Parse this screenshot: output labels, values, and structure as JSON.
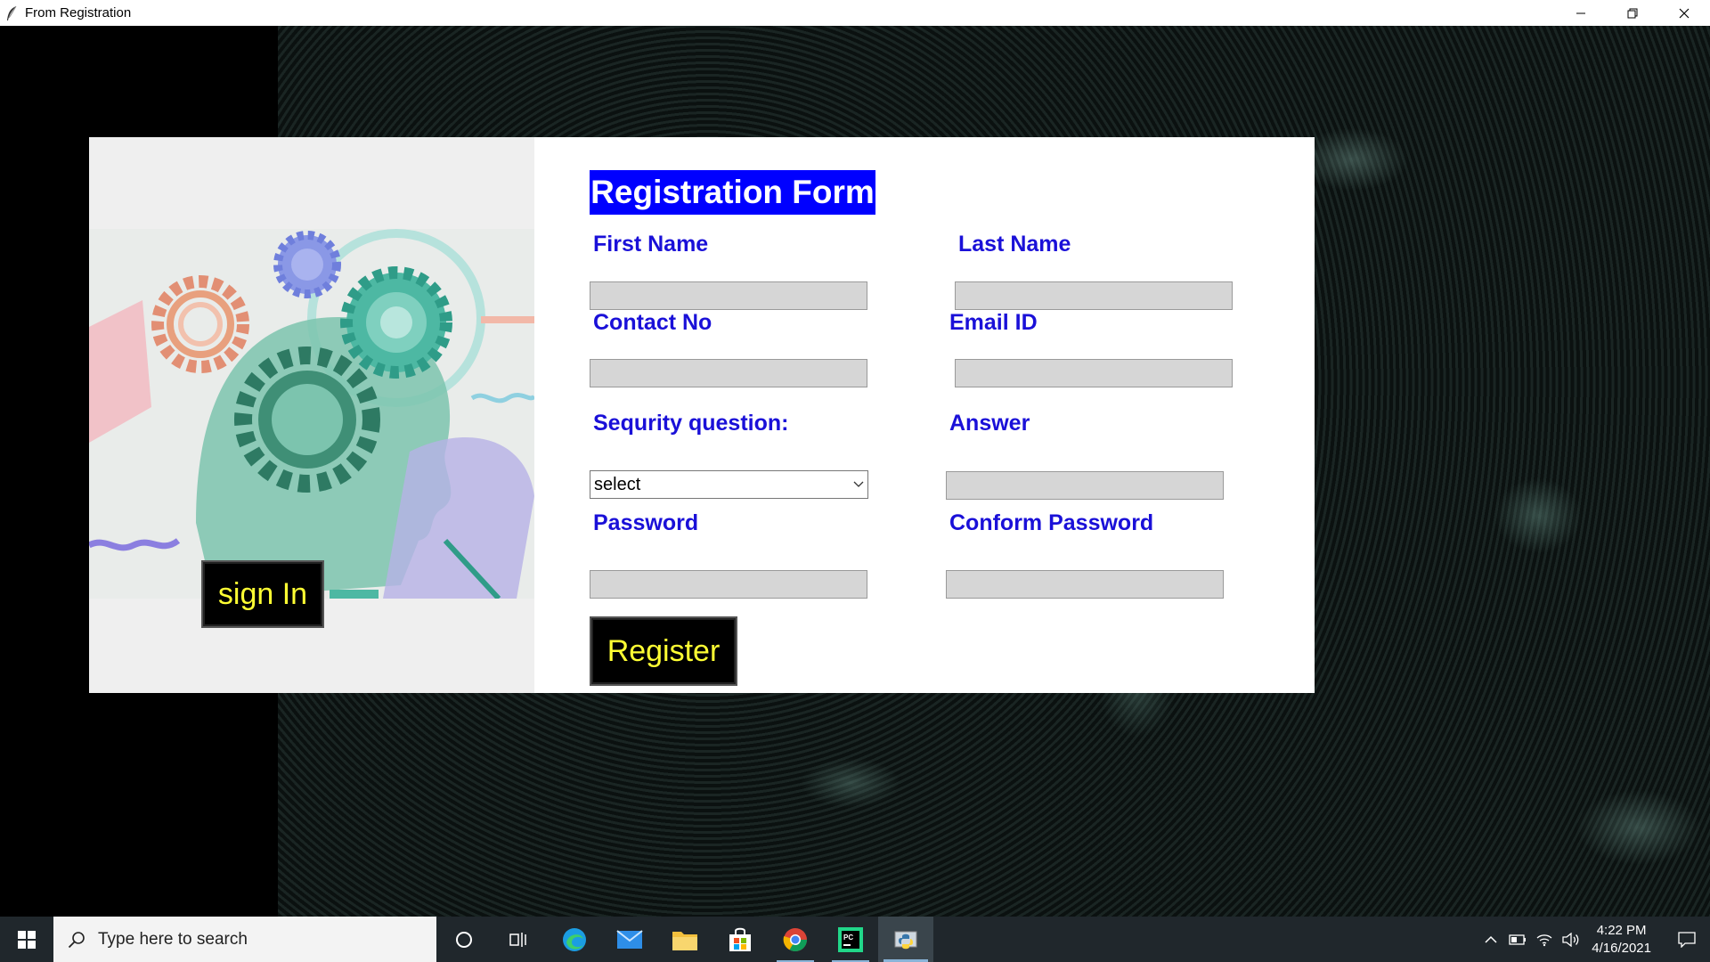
{
  "window": {
    "title": "From Registration",
    "controls": [
      "minimize",
      "restore",
      "close"
    ]
  },
  "left_panel": {
    "illustration": "head-with-gears-illustration",
    "signin_label": "sign In"
  },
  "form": {
    "title": "Registration Form",
    "first_name_label": "First Name",
    "first_name_value": "",
    "last_name_label": "Last Name",
    "last_name_value": "",
    "contact_label": "Contact No",
    "contact_value": "",
    "email_label": "Email ID",
    "email_value": "",
    "security_label": "Sequrity question:",
    "security_selected": "select",
    "answer_label": "Answer",
    "answer_value": "",
    "password_label": "Password",
    "password_value": "",
    "confirm_label": "Conform Password",
    "confirm_value": "",
    "register_label": "Register"
  },
  "taskbar": {
    "search_placeholder": "Type here to search",
    "apps": [
      "cortana-icon",
      "task-view-icon",
      "edge-icon",
      "mail-icon",
      "file-explorer-icon",
      "store-icon",
      "chrome-icon",
      "pycharm-icon",
      "python-icon"
    ],
    "time": "4:22 PM",
    "date": "4/16/2021"
  },
  "colors": {
    "label_blue": "#1a10d8",
    "title_bg": "#0000ff",
    "button_text": "#ffff33"
  }
}
